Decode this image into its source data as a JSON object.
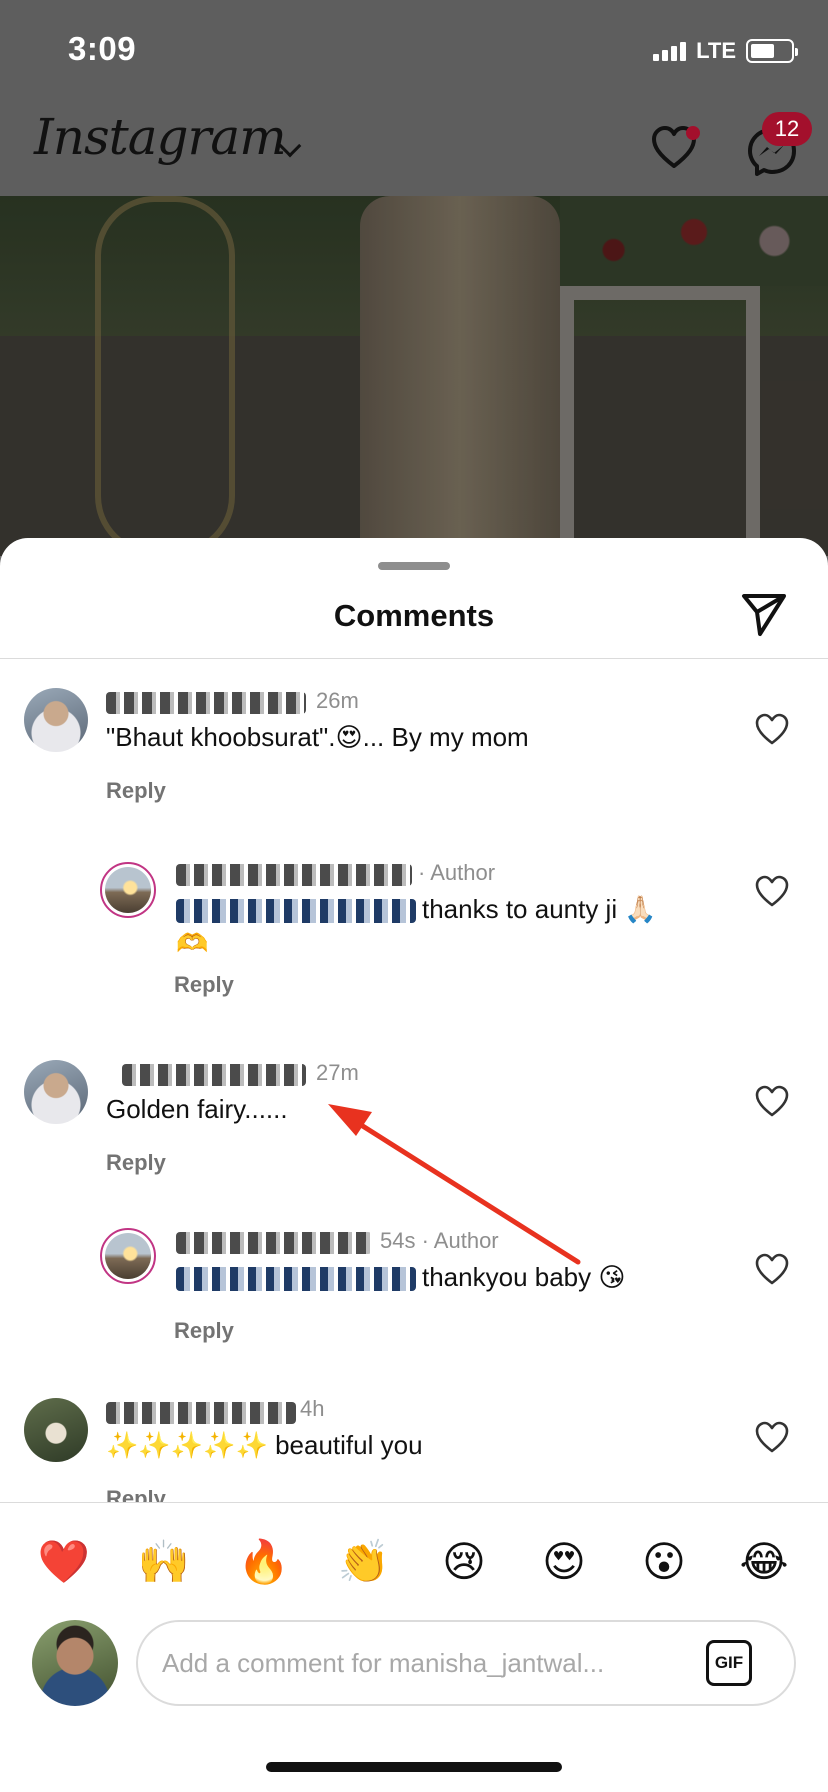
{
  "status_bar": {
    "time": "3:09",
    "network": "LTE",
    "battery_percent": 60
  },
  "header": {
    "logo": "Instagram",
    "notification_dot_color": "#a3102c",
    "messages_badge": "12"
  },
  "sheet": {
    "title": "Comments"
  },
  "comments": [
    {
      "time": "26m",
      "text": "\"Bhaut khoobsurat\".😍... By my mom",
      "reply_label": "Reply"
    },
    {
      "meta": "· Author",
      "text": "thanks to aunty ji 🙏🏻",
      "second_line": "🫶",
      "reply_label": "Reply"
    },
    {
      "time": "27m",
      "text": "Golden fairy......",
      "reply_label": "Reply"
    },
    {
      "meta": "54s · Author",
      "text": "thankyou baby 😘",
      "reply_label": "Reply"
    },
    {
      "time": "4h",
      "text": "✨✨✨✨✨ beautiful you",
      "reply_label": "Reply"
    }
  ],
  "emoji_bar": [
    "❤️",
    "🙌",
    "🔥",
    "👏",
    "😢",
    "😍",
    "😮",
    "😂"
  ],
  "composer": {
    "placeholder": "Add a comment for manisha_jantwal...",
    "gif_label": "GIF"
  },
  "colors": {
    "accent_red": "#e8321f",
    "badge": "#a3102c",
    "story_ring": "#c13584"
  }
}
